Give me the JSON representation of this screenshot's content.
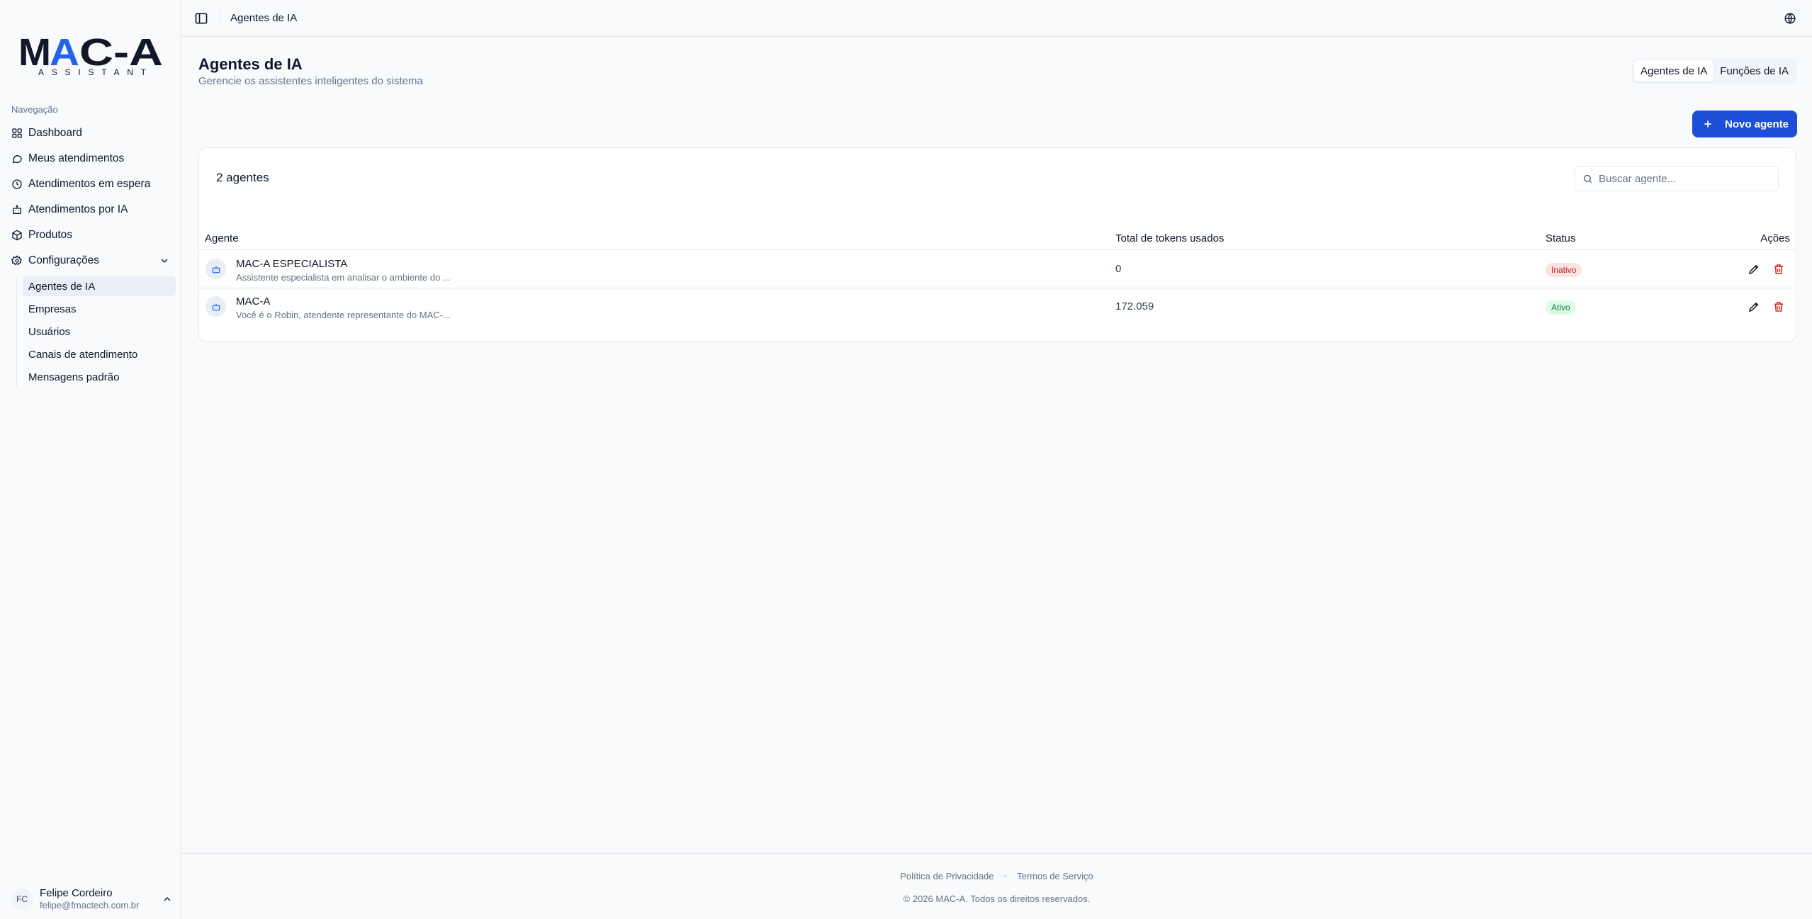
{
  "colors": {
    "accent": "#1d4ed8",
    "brand_blue": "#2563eb",
    "inactive": "#b91c1c",
    "active": "#15803d"
  },
  "logo": {
    "text_left": "M",
    "text_a": "A",
    "text_right": "C-A",
    "tagline": "ASSISTANT"
  },
  "sidebar": {
    "nav_label": "Navegação",
    "items": [
      {
        "label": "Dashboard",
        "icon": "grid-icon"
      },
      {
        "label": "Meus atendimentos",
        "icon": "message-icon"
      },
      {
        "label": "Atendimentos em espera",
        "icon": "clock-icon"
      },
      {
        "label": "Atendimentos por IA",
        "icon": "bot-icon"
      },
      {
        "label": "Produtos",
        "icon": "box-icon"
      },
      {
        "label": "Configurações",
        "icon": "gear-icon"
      }
    ],
    "subitems": [
      {
        "label": "Agentes de IA",
        "active": true
      },
      {
        "label": "Empresas"
      },
      {
        "label": "Usuários"
      },
      {
        "label": "Canais de atendimento"
      },
      {
        "label": "Mensagens padrão"
      }
    ],
    "user": {
      "initials": "FC",
      "name": "Felipe Cordeiro",
      "email": "felipe@fmactech.com.br"
    }
  },
  "topbar": {
    "breadcrumb": "Agentes de IA"
  },
  "page": {
    "title": "Agentes de IA",
    "subtitle": "Gerencie os assistentes inteligentes do sistema",
    "tabs": [
      {
        "label": "Agentes de IA",
        "active": true
      },
      {
        "label": "Funções de IA"
      }
    ],
    "new_button": "Novo agente"
  },
  "table": {
    "count": "2 agentes",
    "search_placeholder": "Buscar agente...",
    "columns": [
      "Agente",
      "Total de tokens usados",
      "Status",
      "Ações"
    ],
    "rows": [
      {
        "name": "MAC-A ESPECIALISTA",
        "description": "Assistente especialista em analisar o ambiente do ...",
        "tokens": "0",
        "status": "Inativo"
      },
      {
        "name": "MAC-A",
        "description": "Você é o Robin, atendente representante do MAC-...",
        "tokens": "172.059",
        "status": "Ativo"
      }
    ]
  },
  "footer": {
    "privacy": "Política de Privacidade",
    "terms": "Termos de Serviço",
    "copyright": "© 2026 MAC-A. Todos os direitos reservados."
  }
}
